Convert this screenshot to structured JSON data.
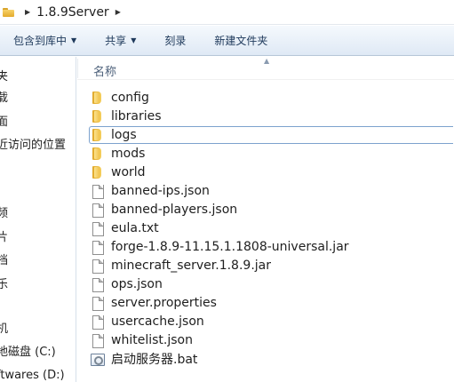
{
  "address": {
    "crumbs": [
      "1.8.9Server"
    ]
  },
  "toolbar": {
    "include_in_library": "包含到库中",
    "share": "共享",
    "burn": "刻录",
    "new_folder": "新建文件夹"
  },
  "nav": {
    "items": [
      "夹",
      "载",
      "面",
      "近访问的位置",
      "频",
      "片",
      "档",
      "乐",
      "机",
      "地磁盘 (C:)",
      "ftwares (D:)"
    ]
  },
  "columns": {
    "name": "名称"
  },
  "files": [
    {
      "name": "config",
      "type": "folder"
    },
    {
      "name": "libraries",
      "type": "folder"
    },
    {
      "name": "logs",
      "type": "folder",
      "selected": true
    },
    {
      "name": "mods",
      "type": "folder"
    },
    {
      "name": "world",
      "type": "folder"
    },
    {
      "name": "banned-ips.json",
      "type": "file"
    },
    {
      "name": "banned-players.json",
      "type": "file"
    },
    {
      "name": "eula.txt",
      "type": "file"
    },
    {
      "name": "forge-1.8.9-11.15.1.1808-universal.jar",
      "type": "file"
    },
    {
      "name": "minecraft_server.1.8.9.jar",
      "type": "file"
    },
    {
      "name": "ops.json",
      "type": "file"
    },
    {
      "name": "server.properties",
      "type": "file"
    },
    {
      "name": "usercache.json",
      "type": "file"
    },
    {
      "name": "whitelist.json",
      "type": "file"
    },
    {
      "name": "启动服务器.bat",
      "type": "bat"
    }
  ],
  "icons": {
    "folder": "folder-icon",
    "file": "file-icon",
    "bat": "batch-file-icon"
  }
}
